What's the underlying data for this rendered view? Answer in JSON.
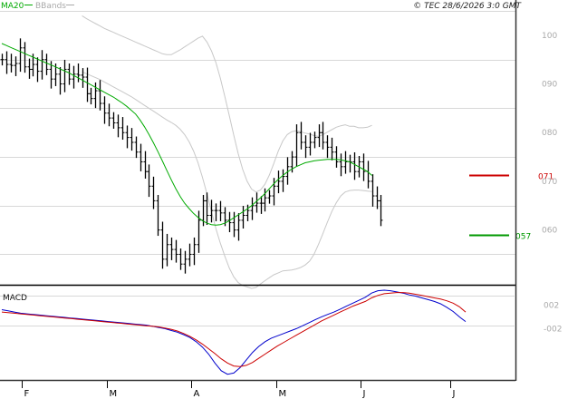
{
  "chart_data": [
    {
      "type": "ohlc",
      "legend": [
        {
          "label": "MA20",
          "color": "#00aa00"
        },
        {
          "label": "BBands",
          "color": "#a9a9a9"
        }
      ],
      "copyright": "© TEC 28/6/2026 3:0 GMT",
      "y_ticks": [
        "100",
        "090",
        "080",
        "070",
        "060"
      ],
      "y_tick_values": [
        100,
        90,
        80,
        70,
        60
      ],
      "ylim": [
        49.5,
        105
      ],
      "x_labels": [
        "F",
        "M",
        "A",
        "M",
        "J",
        "J"
      ],
      "x_label_positions": [
        4.5,
        23.5,
        42.5,
        61.5,
        80.5,
        100.5
      ],
      "xlim": [
        0,
        104
      ],
      "resistance": {
        "label": "071",
        "value": 71.2,
        "color": "#cc0000"
      },
      "support": {
        "label": "057",
        "value": 59.0,
        "color": "#009900"
      },
      "closes": [
        95,
        94,
        93.8,
        94.2,
        97.4,
        93.5,
        93,
        94,
        92.6,
        95,
        93,
        91,
        92,
        90,
        93,
        91,
        92,
        91.8,
        91.4,
        88,
        87,
        88.6,
        86,
        84,
        83,
        82,
        81,
        80,
        79,
        78,
        76,
        74,
        72,
        69,
        66,
        60,
        54,
        57,
        56,
        55,
        53,
        54,
        55,
        57,
        62,
        66,
        63,
        64,
        64,
        63.5,
        62,
        61.5,
        60,
        62,
        63,
        64,
        65,
        65.5,
        65.5,
        66.6,
        67,
        69,
        70,
        71,
        73,
        75,
        80,
        78,
        77,
        78,
        79,
        80,
        78,
        77,
        76,
        74,
        73,
        74,
        74,
        72,
        74,
        72,
        70,
        67,
        66,
        62
      ],
      "ma20": [
        98.3,
        97.9,
        97.5,
        97.1,
        96.7,
        96.3,
        95.9,
        95.5,
        95.1,
        94.7,
        94.3,
        93.9,
        93.5,
        93.1,
        92.7,
        92.3,
        91.8,
        91.3,
        90.8,
        90.3,
        89.8,
        89.3,
        88.8,
        88.3,
        87.8,
        87.3,
        86.7,
        86.1,
        85.4,
        84.6,
        83.8,
        82.6,
        81.2,
        79.6,
        77.9,
        76.1,
        74.2,
        72.2,
        70.3,
        68.5,
        66.9,
        65.5,
        64.4,
        63.4,
        62.6,
        61.9,
        61.4,
        61.1,
        61.0,
        61.1,
        61.4,
        61.9,
        62.5,
        63.1,
        63.7,
        64.3,
        65,
        65.8,
        66.6,
        67.5,
        68.5,
        69.5,
        70.4,
        71.2,
        71.9,
        72.5,
        73,
        73.4,
        73.8,
        74,
        74.2,
        74.3,
        74.4,
        74.5,
        74.5,
        74.5,
        74.4,
        74.2,
        74,
        73.5,
        73,
        72.5,
        72,
        71.2
      ],
      "bb_upper": [
        104,
        103.4,
        102.9,
        102.4,
        101.9,
        101.4,
        101,
        100.6,
        100.2,
        99.8,
        99.4,
        99,
        98.6,
        98.2,
        97.8,
        97.4,
        97,
        96.6,
        96.2,
        96,
        96,
        96.5,
        97,
        97.6,
        98.2,
        98.8,
        99.4,
        99.8,
        98.6,
        96.8,
        94.4,
        91.2,
        87.4,
        83.5,
        79.5,
        75.7,
        72.5,
        70,
        68.4,
        67.8,
        68.2,
        69.4,
        71.3,
        73.7,
        76.2,
        78.3,
        79.6,
        80.2,
        80.4,
        80.2,
        79.9,
        79.7,
        79.4,
        79.2,
        79.6,
        80.1,
        80.6,
        81.1,
        81.4,
        81.6,
        81.3,
        81.3,
        81,
        81,
        81.1,
        81.5
      ],
      "bb_upper_start": 18,
      "bb_lower": [
        92.5,
        92.1,
        91.7,
        91.3,
        90.9,
        90.4,
        89.9,
        89.4,
        88.9,
        88.4,
        87.9,
        87.4,
        86.8,
        86.2,
        85.6,
        85,
        84.4,
        83.8,
        83.2,
        82.6,
        82.1,
        81.5,
        80.7,
        79.6,
        78.1,
        76.2,
        73.8,
        70.8,
        67.4,
        63.8,
        60.3,
        57.3,
        54.6,
        52.2,
        50.4,
        49.2,
        48.6,
        48.3,
        48,
        48.2,
        48.9,
        49.6,
        50.2,
        50.8,
        51.2,
        51.6,
        51.7,
        51.8,
        52,
        52.3,
        52.8,
        53.6,
        55,
        57,
        59.3,
        61.6,
        63.8,
        65.6,
        67,
        67.8,
        68.1,
        68.2,
        68.2,
        68.1,
        68,
        67.9
      ],
      "bb_lower_start": 18
    },
    {
      "type": "line",
      "title": "MACD",
      "y_ticks": [
        "002",
        "-002"
      ],
      "y_tick_values": [
        2,
        -2
      ],
      "ylim": [
        -10.2,
        4.8
      ],
      "series": [
        {
          "color": "#0000cc",
          "values": [
            1.2,
            1.0,
            0.8,
            0.6,
            0.5,
            0.4,
            0.3,
            0.2,
            0.1,
            0.0,
            -0.1,
            -0.2,
            -0.3,
            -0.4,
            -0.5,
            -0.6,
            -0.7,
            -0.8,
            -0.9,
            -1,
            -1.1,
            -1.2,
            -1.3,
            -1.4,
            -1.6,
            -1.8,
            -2,
            -2.3,
            -2.6,
            -3,
            -3.5,
            -4.2,
            -5.1,
            -6.3,
            -7.8,
            -9.1,
            -9.7,
            -9.5,
            -8.6,
            -7.3,
            -6,
            -5,
            -4.2,
            -3.6,
            -3.2,
            -2.8,
            -2.4,
            -2,
            -1.5,
            -1,
            -0.5,
            0,
            0.4,
            0.8,
            1.3,
            1.8,
            2.3,
            2.8,
            3.3,
            4,
            4.4,
            4.5,
            4.4,
            4.2,
            4,
            3.7,
            3.5,
            3.2,
            2.9,
            2.6,
            2.2,
            1.6,
            0.9,
            0.0,
            -0.8
          ]
        },
        {
          "color": "#cc0000",
          "values": [
            0.8,
            0.7,
            0.6,
            0.5,
            0.4,
            0.3,
            0.2,
            0.1,
            0.0,
            -0.1,
            -0.2,
            -0.3,
            -0.4,
            -0.5,
            -0.6,
            -0.7,
            -0.8,
            -0.9,
            -1.0,
            -1.1,
            -1.2,
            -1.3,
            -1.4,
            -1.5,
            -1.6,
            -1.7,
            -1.9,
            -2.1,
            -2.4,
            -2.8,
            -3.3,
            -3.9,
            -4.6,
            -5.4,
            -6.2,
            -7.1,
            -7.8,
            -8.3,
            -8.4,
            -8.2,
            -7.7,
            -7,
            -6.3,
            -5.6,
            -4.9,
            -4.3,
            -3.7,
            -3.1,
            -2.5,
            -1.9,
            -1.3,
            -0.7,
            -0.2,
            0.3,
            0.8,
            1.3,
            1.8,
            2.2,
            2.6,
            3.2,
            3.6,
            3.9,
            4,
            4.1,
            4.1,
            4,
            3.8,
            3.6,
            3.4,
            3.2,
            3,
            2.7,
            2.3,
            1.7,
            0.8
          ]
        }
      ]
    }
  ]
}
